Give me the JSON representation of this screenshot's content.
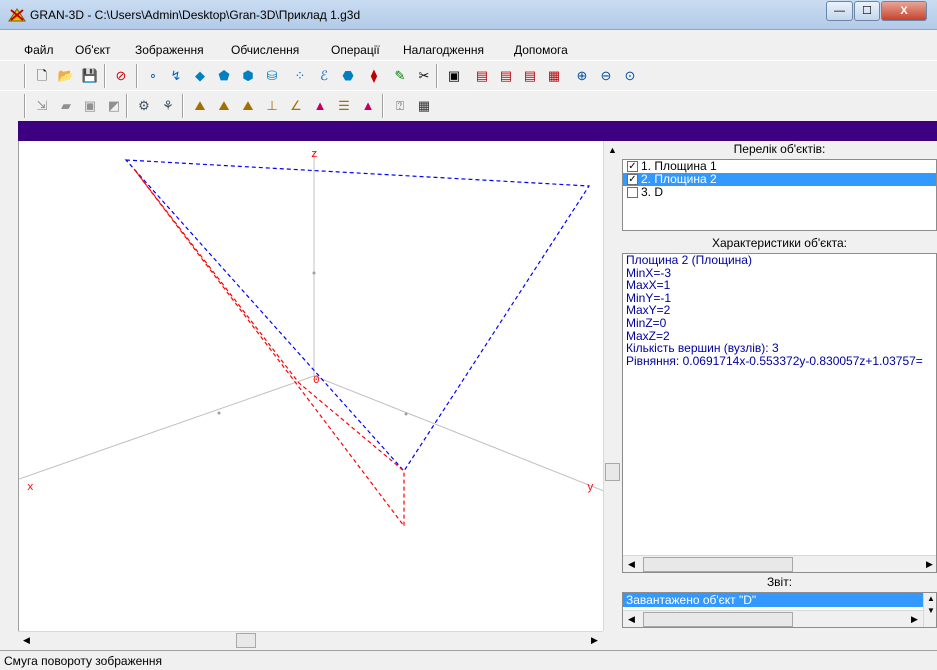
{
  "window": {
    "title": "GRAN-3D - C:\\Users\\Admin\\Desktop\\Gran-3D\\Приклад 1.g3d",
    "minimize": "—",
    "maximize": "☐",
    "close": "X"
  },
  "menu": [
    "Файл",
    "Об'єкт",
    "Зображення",
    "Обчислення",
    "Операції",
    "Налагодження",
    "Допомога"
  ],
  "axes": {
    "z": "z",
    "x": "x",
    "y": "y",
    "origin": "0"
  },
  "panels": {
    "objects_title": "Перелік об'єктів:",
    "objects": [
      {
        "label": "1. Площина 1",
        "checked": true
      },
      {
        "label": "2. Площина 2",
        "checked": true
      },
      {
        "label": "3. D",
        "checked": false
      }
    ],
    "props_title": "Характеристики об'єкта:",
    "props": [
      "Площина 2 (Площина)",
      "MinX=-3",
      "MaxX=1",
      "MinY=-1",
      "MaxY=2",
      "MinZ=0",
      "MaxZ=2",
      "Кількість вершин (вузлів): 3",
      "Рівняння: 0.0691714x-0.553372y-0.830057z+1.03757="
    ],
    "report_title": "Звіт:",
    "report": "Завантажено об'єкт \"D\""
  },
  "status": "Смуга повороту зображення",
  "colors": {
    "accent_bar": "#3c0080",
    "selection": "#3399ff",
    "red_line": "#ff0000",
    "blue_line": "#0000ff"
  }
}
